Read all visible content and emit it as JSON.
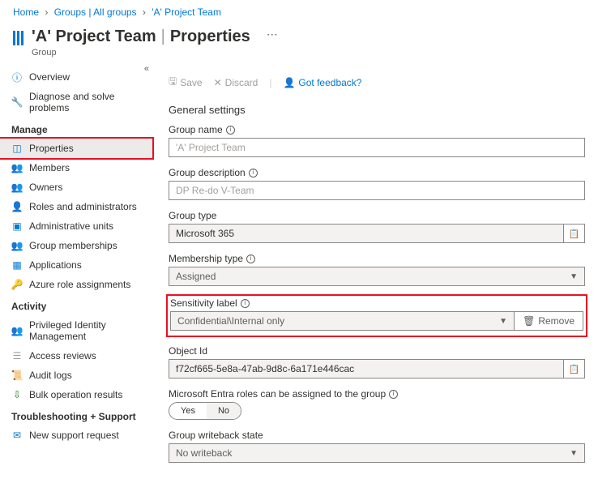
{
  "breadcrumb": {
    "home": "Home",
    "groups": "Groups | All groups",
    "current": "'A' Project Team"
  },
  "header": {
    "title": "'A' Project Team",
    "page": "Properties",
    "subtitle": "Group"
  },
  "toolbar": {
    "save": "Save",
    "discard": "Discard",
    "feedback": "Got feedback?"
  },
  "nav": {
    "overview": "Overview",
    "diagnose": "Diagnose and solve problems",
    "manage_title": "Manage",
    "properties": "Properties",
    "members": "Members",
    "owners": "Owners",
    "roles": "Roles and administrators",
    "admin_units": "Administrative units",
    "group_memberships": "Group memberships",
    "applications": "Applications",
    "azure_role": "Azure role assignments",
    "activity_title": "Activity",
    "pim": "Privileged Identity Management",
    "access_reviews": "Access reviews",
    "audit_logs": "Audit logs",
    "bulk_op": "Bulk operation results",
    "troubleshoot_title": "Troubleshooting + Support",
    "new_support": "New support request"
  },
  "section_title": "General settings",
  "fields": {
    "group_name_label": "Group name",
    "group_name_value": "'A' Project Team",
    "group_desc_label": "Group description",
    "group_desc_value": "DP Re-do V-Team",
    "group_type_label": "Group type",
    "group_type_value": "Microsoft 365",
    "membership_label": "Membership type",
    "membership_value": "Assigned",
    "sensitivity_label": "Sensitivity label",
    "sensitivity_value": "Confidential\\Internal only",
    "remove": "Remove",
    "object_id_label": "Object Id",
    "object_id_value": "f72cf665-5e8a-47ab-9d8c-6a171e446cac",
    "entra_label": "Microsoft Entra roles can be assigned to the group",
    "yes": "Yes",
    "no": "No",
    "writeback_label": "Group writeback state",
    "writeback_value": "No writeback"
  }
}
